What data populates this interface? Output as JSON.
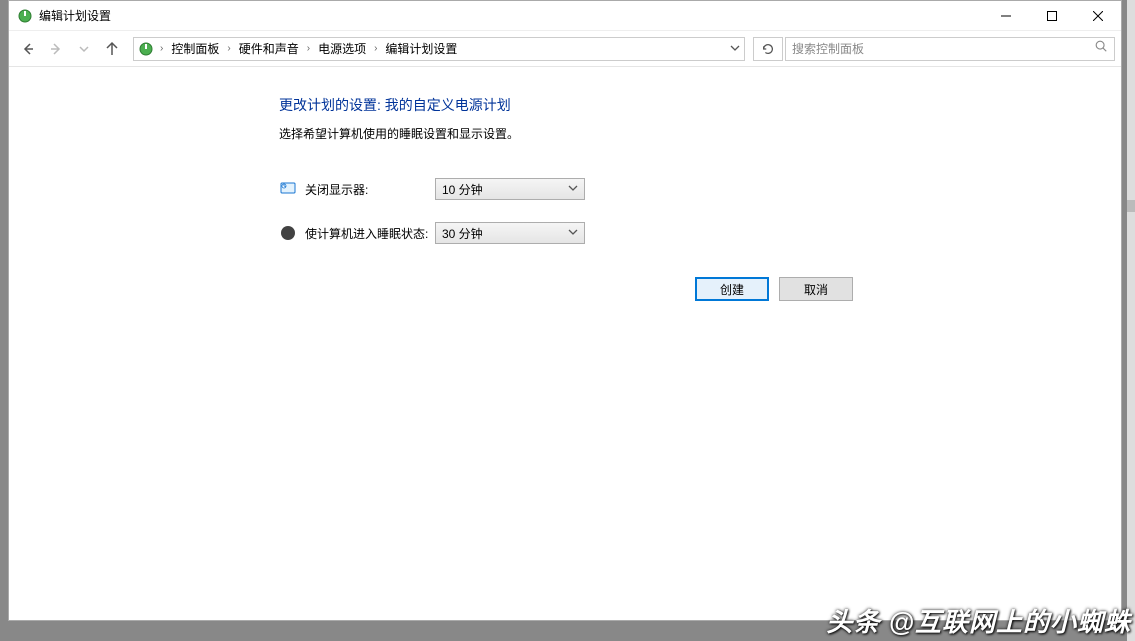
{
  "window": {
    "title": "编辑计划设置"
  },
  "breadcrumb": {
    "items": [
      "控制面板",
      "硬件和声音",
      "电源选项",
      "编辑计划设置"
    ]
  },
  "search": {
    "placeholder": "搜索控制面板"
  },
  "page": {
    "heading": "更改计划的设置: 我的自定义电源计划",
    "subheading": "选择希望计算机使用的睡眠设置和显示设置。"
  },
  "settings": {
    "turn_off_display": {
      "label": "关闭显示器:",
      "value": "10 分钟"
    },
    "sleep": {
      "label": "使计算机进入睡眠状态:",
      "value": "30 分钟"
    }
  },
  "buttons": {
    "create": "创建",
    "cancel": "取消"
  },
  "watermark": "头条 @互联网上的小蜘蛛"
}
